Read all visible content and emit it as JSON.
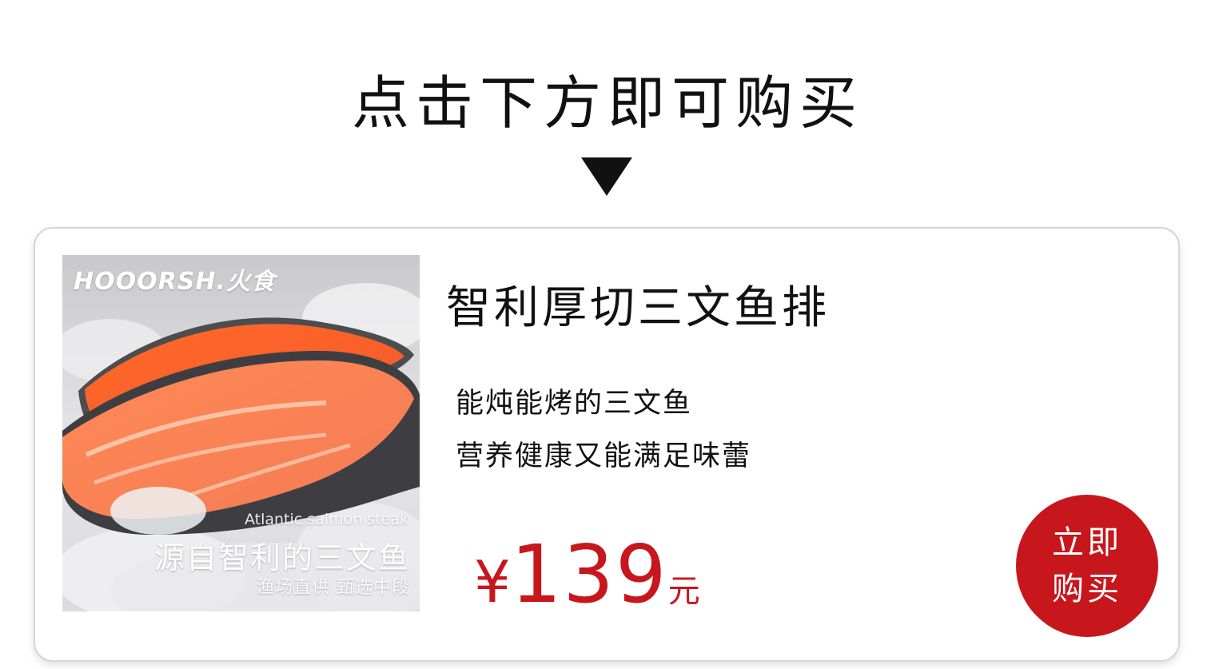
{
  "header": {
    "title": "点击下方即可购买",
    "arrow_icon": "triangle-down-icon"
  },
  "product": {
    "image": {
      "brand": "HOOORSH.火食",
      "subtitle_en": "Atlantic salmon steak",
      "title": "源自智利的三文鱼",
      "tagline": "渔场直供 甄选中段"
    },
    "name": "智利厚切三文鱼排",
    "description": [
      "能炖能烤的三文鱼",
      "营养健康又能满足味蕾"
    ],
    "price": {
      "symbol": "¥",
      "value": "139",
      "unit": "元"
    },
    "buy_button": {
      "line1": "立即",
      "line2": "购买"
    }
  },
  "colors": {
    "accent": "#c8161d",
    "text": "#111111",
    "card_border": "#d6d6d6"
  }
}
